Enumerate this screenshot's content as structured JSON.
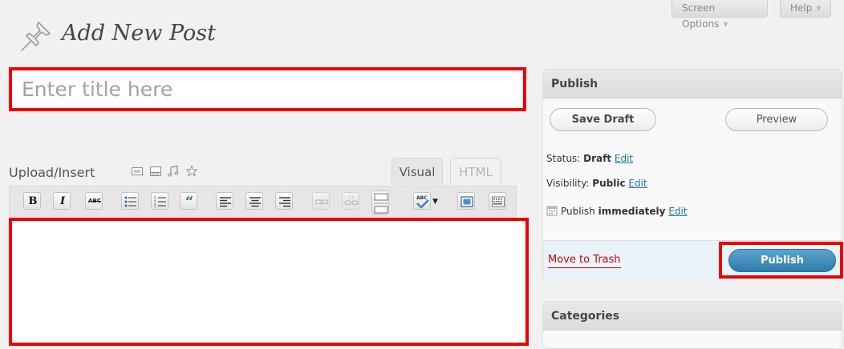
{
  "header": {
    "screen_options": "Screen Options",
    "help": "Help",
    "page_title": "Add New Post"
  },
  "title_input": {
    "placeholder": "Enter title here",
    "value": ""
  },
  "editor": {
    "upload_label": "Upload/Insert",
    "media_icons": [
      "image-icon",
      "video-icon",
      "audio-icon",
      "media-icon"
    ],
    "tabs": [
      {
        "label": "Visual",
        "active": true
      },
      {
        "label": "HTML",
        "active": false
      }
    ],
    "toolbar_buttons": [
      "bold-icon",
      "italic-icon",
      "strikethrough-icon",
      "unordered-list-icon",
      "ordered-list-icon",
      "blockquote-icon",
      "align-left-icon",
      "align-center-icon",
      "align-right-icon",
      "link-icon",
      "unlink-icon",
      "more-tag-icon",
      "spellcheck-icon",
      "dropdown-arrow-icon",
      "fullscreen-icon",
      "kitchen-sink-icon"
    ],
    "bold_label": "B",
    "italic_label": "I",
    "strike_label": "ABC",
    "quote_label": "“",
    "spell_label": "ABC"
  },
  "publish_box": {
    "title": "Publish",
    "save_draft": "Save Draft",
    "preview": "Preview",
    "status_label": "Status:",
    "status_value": "Draft",
    "visibility_label": "Visibility:",
    "visibility_value": "Public",
    "publish_label": "Publish",
    "publish_value": "immediately",
    "edit_link": "Edit",
    "move_to_trash": "Move to Trash",
    "publish_button": "Publish"
  },
  "categories_box": {
    "title": "Categories"
  },
  "colors": {
    "highlight": "#e00000",
    "link": "#21759b",
    "trash": "#bc0b0b",
    "primary_button": "#2e7aab"
  }
}
